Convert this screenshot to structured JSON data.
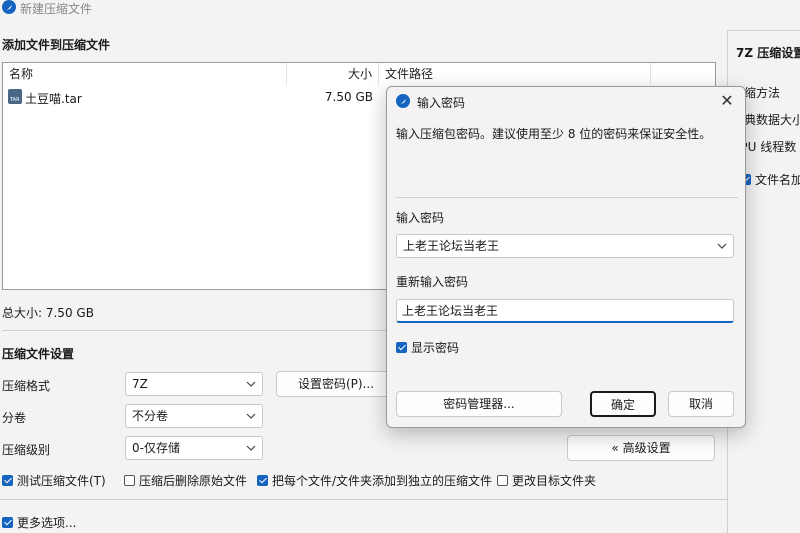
{
  "window": {
    "title": "新建压缩文件"
  },
  "files_section": {
    "title": "添加文件到压缩文件",
    "columns": [
      "名称",
      "大小",
      "文件路径"
    ],
    "rows": [
      {
        "name": "土豆喵.tar",
        "size": "7.50 GB",
        "path": ""
      }
    ],
    "total_size": "总大小: 7.50 GB"
  },
  "settings_section": {
    "title": "压缩文件设置",
    "format_label": "压缩格式",
    "format_value": "7Z",
    "split_label": "分卷",
    "split_value": "不分卷",
    "level_label": "压缩级别",
    "level_value": "0-仅存储",
    "set_password_label": "设置密码(P)...",
    "advanced_label": "« 高级设置"
  },
  "checkboxes": {
    "test": "测试压缩文件(T)",
    "delete_after": "压缩后删除原始文件",
    "each_separate": "把每个文件/文件夹添加到独立的压缩文件",
    "change_target": "更改目标文件夹",
    "more_options": "更多选项..."
  },
  "right_panel": {
    "title": "7Z 压缩设置",
    "method": "压缩方法",
    "dict": "字典数据大小",
    "threads": "CPU 线程数",
    "encrypt_names": "文件名加密"
  },
  "dialog": {
    "title": "输入密码",
    "hint": "输入压缩包密码。建议使用至少 8 位的密码来保证安全性。",
    "password_label": "输入密码",
    "password_value": "上老王论坛当老王",
    "confirm_label": "重新输入密码",
    "confirm_value": "上老王论坛当老王",
    "show_password": "显示密码",
    "manager_button": "密码管理器...",
    "ok_button": "确定",
    "cancel_button": "取消"
  },
  "colors": {
    "accent": "#1565c0",
    "background": "#f3f3f3"
  }
}
